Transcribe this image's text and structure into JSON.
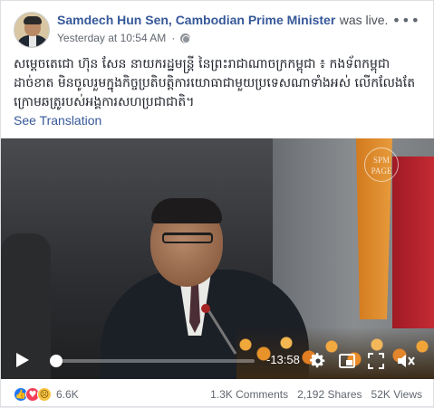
{
  "post": {
    "author": "Samdech Hun Sen, Cambodian Prime Minister",
    "status": "was live.",
    "timestamp": "Yesterday at 10:54 AM",
    "separator": "·",
    "more_label": "•••",
    "text": "សម្តេចតេជោ ហ៊ុន សែន នាយករដ្ឋមន្ត្រី នៃព្រះរាជាណាចក្រកម្ពុជា ៖ កងទ័ពកម្ពុជាដាច់ខាត មិនចូលរួមក្នុងកិច្ចប្រតិបត្តិការយោធាជាមួយប្រទេសណាទាំងអស់ លើកលែងតែក្រោមឆត្រូរបស់អង្គការសហប្រជាជាតិ។",
    "see_translation": "See Translation"
  },
  "video": {
    "watermark": "SPM PAGE",
    "remaining_time": "-13:58",
    "progress": 0.0
  },
  "icons": {
    "privacy": "globe-icon",
    "play": "play-icon",
    "settings": "gear-icon",
    "pip": "picture-in-picture-icon",
    "fullscreen": "fullscreen-icon",
    "volume": "volume-icon"
  },
  "footer": {
    "reaction_count": "6.6K",
    "comments": "1.3K Comments",
    "shares": "2,192 Shares",
    "views": "52K Views"
  },
  "colors": {
    "link": "#365899",
    "like": "#2078f4",
    "love": "#f33e58",
    "sad": "#f7c342"
  }
}
